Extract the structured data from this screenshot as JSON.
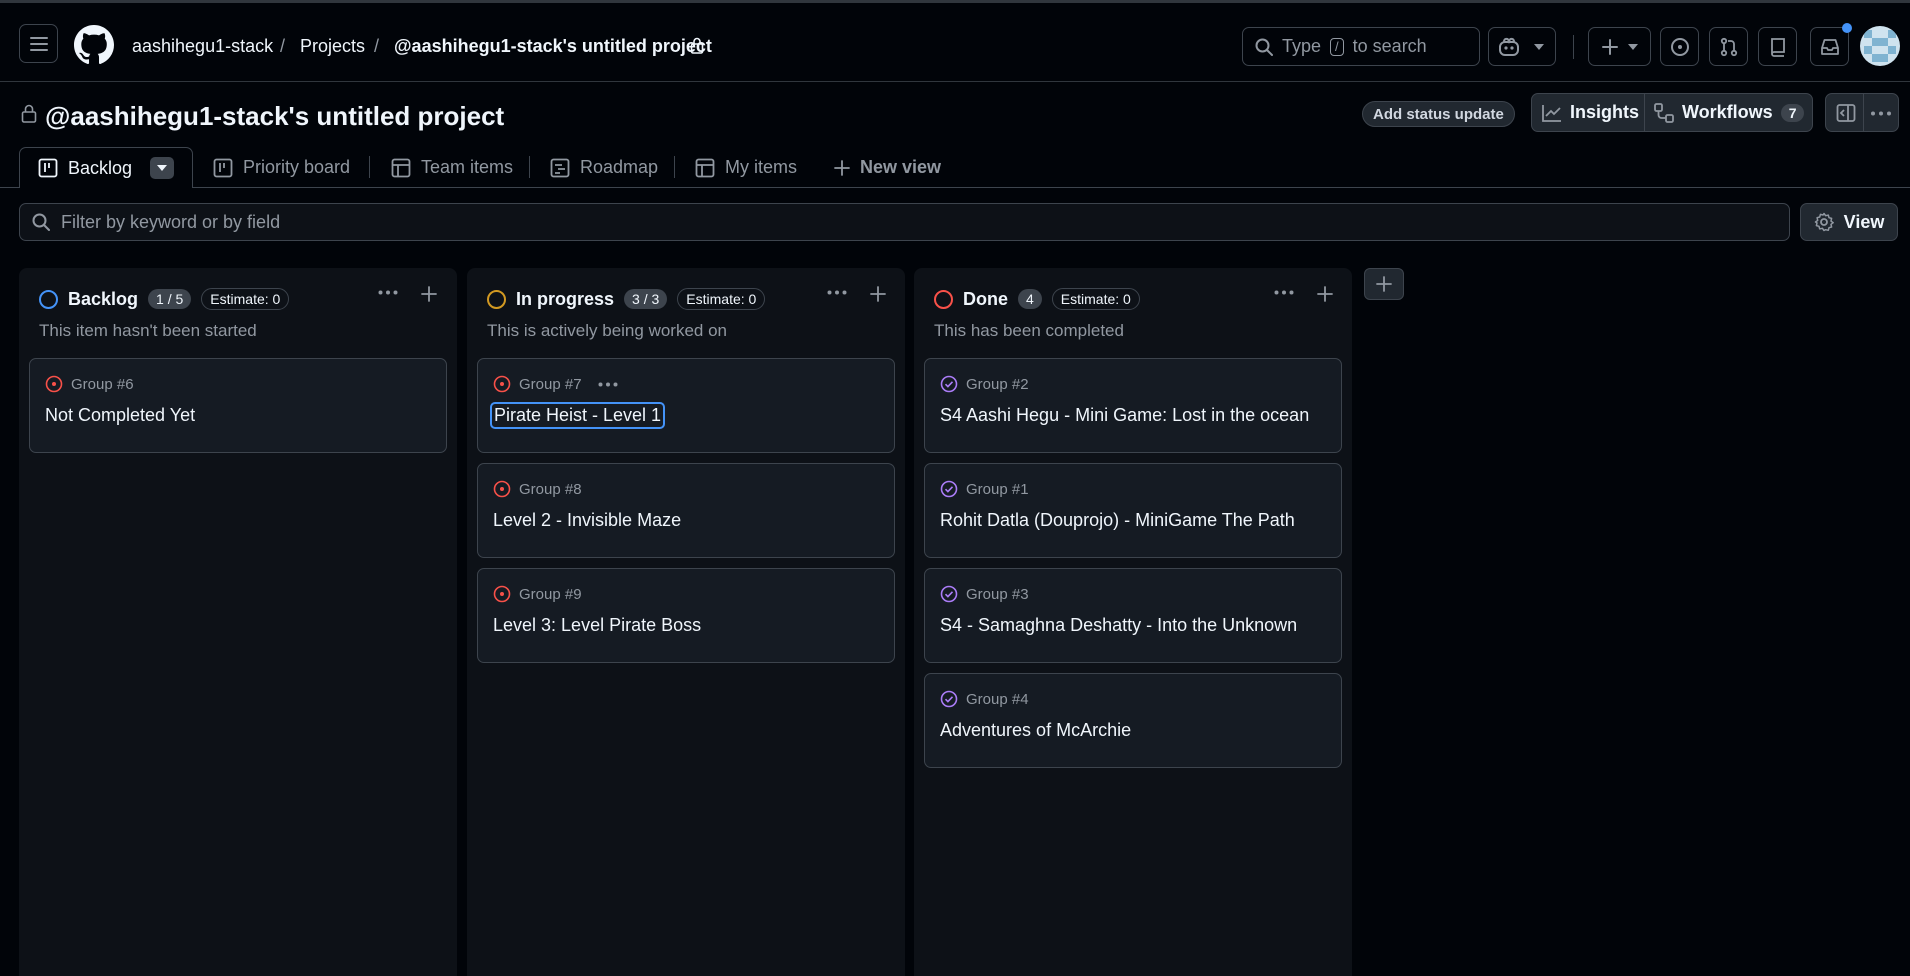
{
  "header": {
    "owner": "aashihegu1-stack",
    "separator": "/",
    "projects": "Projects",
    "project": "@aashihegu1-stack's untitled project",
    "search_prefix": "Type",
    "search_key": "/",
    "search_suffix": "to search"
  },
  "project_bar": {
    "title": "@aashihegu1-stack's untitled project",
    "status_update": "Add status update",
    "insights": "Insights",
    "workflows": "Workflows",
    "workflows_count": "7"
  },
  "tabs": [
    {
      "label": "Backlog",
      "icon": "board-icon"
    },
    {
      "label": "Priority board",
      "icon": "board-icon"
    },
    {
      "label": "Team items",
      "icon": "table-icon"
    },
    {
      "label": "Roadmap",
      "icon": "roadmap-icon"
    },
    {
      "label": "My items",
      "icon": "table-icon"
    },
    {
      "label": "New view",
      "icon": "plus-icon"
    }
  ],
  "filter": {
    "placeholder": "Filter by keyword or by field",
    "view_label": "View"
  },
  "columns": [
    {
      "name": "Backlog",
      "count": "1 / 5",
      "estimate": "Estimate: 0",
      "description": "This item hasn't been started",
      "color": "#4493f8",
      "cards": [
        {
          "group": "Group #6",
          "title": "Not Completed Yet",
          "state": "open"
        }
      ]
    },
    {
      "name": "In progress",
      "count": "3 / 3",
      "estimate": "Estimate: 0",
      "description": "This is actively being worked on",
      "color": "#d29922",
      "cards": [
        {
          "group": "Group #7",
          "title": "Pirate Heist - Level 1",
          "state": "open"
        },
        {
          "group": "Group #8",
          "title": "Level 2 - Invisible Maze",
          "state": "open"
        },
        {
          "group": "Group #9",
          "title": "Level 3: Level Pirate Boss",
          "state": "open"
        }
      ]
    },
    {
      "name": "Done",
      "count": "4",
      "estimate": "Estimate: 0",
      "description": "This has been completed",
      "color": "#f85149",
      "cards": [
        {
          "group": "Group #2",
          "title": "S4 Aashi Hegu - Mini Game: Lost in the ocean",
          "state": "closed"
        },
        {
          "group": "Group #1",
          "title": "Rohit Datla (Douprojo) - MiniGame The Path",
          "state": "closed"
        },
        {
          "group": "Group #3",
          "title": "S4 - Samaghna Deshatty - Into the Unknown",
          "state": "closed"
        },
        {
          "group": "Group #4",
          "title": "Adventures of McArchie",
          "state": "closed"
        }
      ]
    }
  ],
  "colors": {
    "open_issue": "#f85149",
    "closed_issue": "#ab7df8",
    "accent": "#4493f8"
  }
}
